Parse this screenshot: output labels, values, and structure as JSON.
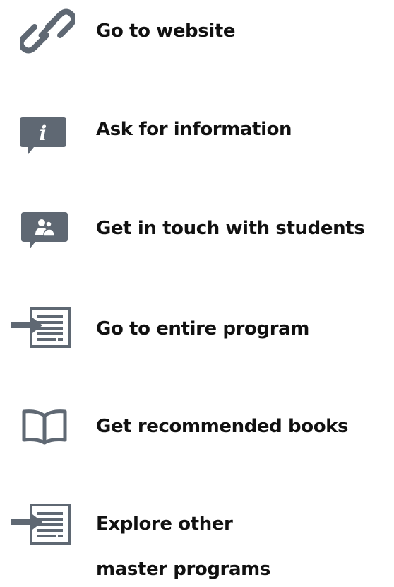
{
  "colors": {
    "icon": "#5f6873",
    "text": "#111111",
    "background": "#ffffff"
  },
  "actions": [
    {
      "label": "Go to website",
      "icon": "link-icon"
    },
    {
      "label": "Ask for information",
      "icon": "info-bubble-icon"
    },
    {
      "label": "Get in touch with students",
      "icon": "contact-bubble-icon"
    },
    {
      "label": "Go to entire program",
      "icon": "document-arrow-icon"
    },
    {
      "label": "Get recommended books",
      "icon": "open-book-icon"
    },
    {
      "label_line1": "Explore other",
      "label_line2": "master programs",
      "icon": "document-arrow-icon"
    }
  ]
}
